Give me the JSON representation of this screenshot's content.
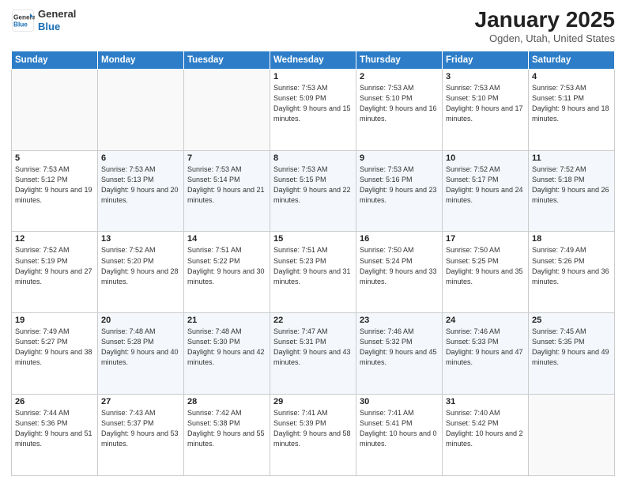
{
  "header": {
    "logo_line1": "General",
    "logo_line2": "Blue",
    "month": "January 2025",
    "location": "Ogden, Utah, United States"
  },
  "days_of_week": [
    "Sunday",
    "Monday",
    "Tuesday",
    "Wednesday",
    "Thursday",
    "Friday",
    "Saturday"
  ],
  "weeks": [
    [
      {
        "num": "",
        "sunrise": "",
        "sunset": "",
        "daylight": ""
      },
      {
        "num": "",
        "sunrise": "",
        "sunset": "",
        "daylight": ""
      },
      {
        "num": "",
        "sunrise": "",
        "sunset": "",
        "daylight": ""
      },
      {
        "num": "1",
        "sunrise": "Sunrise: 7:53 AM",
        "sunset": "Sunset: 5:09 PM",
        "daylight": "Daylight: 9 hours and 15 minutes."
      },
      {
        "num": "2",
        "sunrise": "Sunrise: 7:53 AM",
        "sunset": "Sunset: 5:10 PM",
        "daylight": "Daylight: 9 hours and 16 minutes."
      },
      {
        "num": "3",
        "sunrise": "Sunrise: 7:53 AM",
        "sunset": "Sunset: 5:10 PM",
        "daylight": "Daylight: 9 hours and 17 minutes."
      },
      {
        "num": "4",
        "sunrise": "Sunrise: 7:53 AM",
        "sunset": "Sunset: 5:11 PM",
        "daylight": "Daylight: 9 hours and 18 minutes."
      }
    ],
    [
      {
        "num": "5",
        "sunrise": "Sunrise: 7:53 AM",
        "sunset": "Sunset: 5:12 PM",
        "daylight": "Daylight: 9 hours and 19 minutes."
      },
      {
        "num": "6",
        "sunrise": "Sunrise: 7:53 AM",
        "sunset": "Sunset: 5:13 PM",
        "daylight": "Daylight: 9 hours and 20 minutes."
      },
      {
        "num": "7",
        "sunrise": "Sunrise: 7:53 AM",
        "sunset": "Sunset: 5:14 PM",
        "daylight": "Daylight: 9 hours and 21 minutes."
      },
      {
        "num": "8",
        "sunrise": "Sunrise: 7:53 AM",
        "sunset": "Sunset: 5:15 PM",
        "daylight": "Daylight: 9 hours and 22 minutes."
      },
      {
        "num": "9",
        "sunrise": "Sunrise: 7:53 AM",
        "sunset": "Sunset: 5:16 PM",
        "daylight": "Daylight: 9 hours and 23 minutes."
      },
      {
        "num": "10",
        "sunrise": "Sunrise: 7:52 AM",
        "sunset": "Sunset: 5:17 PM",
        "daylight": "Daylight: 9 hours and 24 minutes."
      },
      {
        "num": "11",
        "sunrise": "Sunrise: 7:52 AM",
        "sunset": "Sunset: 5:18 PM",
        "daylight": "Daylight: 9 hours and 26 minutes."
      }
    ],
    [
      {
        "num": "12",
        "sunrise": "Sunrise: 7:52 AM",
        "sunset": "Sunset: 5:19 PM",
        "daylight": "Daylight: 9 hours and 27 minutes."
      },
      {
        "num": "13",
        "sunrise": "Sunrise: 7:52 AM",
        "sunset": "Sunset: 5:20 PM",
        "daylight": "Daylight: 9 hours and 28 minutes."
      },
      {
        "num": "14",
        "sunrise": "Sunrise: 7:51 AM",
        "sunset": "Sunset: 5:22 PM",
        "daylight": "Daylight: 9 hours and 30 minutes."
      },
      {
        "num": "15",
        "sunrise": "Sunrise: 7:51 AM",
        "sunset": "Sunset: 5:23 PM",
        "daylight": "Daylight: 9 hours and 31 minutes."
      },
      {
        "num": "16",
        "sunrise": "Sunrise: 7:50 AM",
        "sunset": "Sunset: 5:24 PM",
        "daylight": "Daylight: 9 hours and 33 minutes."
      },
      {
        "num": "17",
        "sunrise": "Sunrise: 7:50 AM",
        "sunset": "Sunset: 5:25 PM",
        "daylight": "Daylight: 9 hours and 35 minutes."
      },
      {
        "num": "18",
        "sunrise": "Sunrise: 7:49 AM",
        "sunset": "Sunset: 5:26 PM",
        "daylight": "Daylight: 9 hours and 36 minutes."
      }
    ],
    [
      {
        "num": "19",
        "sunrise": "Sunrise: 7:49 AM",
        "sunset": "Sunset: 5:27 PM",
        "daylight": "Daylight: 9 hours and 38 minutes."
      },
      {
        "num": "20",
        "sunrise": "Sunrise: 7:48 AM",
        "sunset": "Sunset: 5:28 PM",
        "daylight": "Daylight: 9 hours and 40 minutes."
      },
      {
        "num": "21",
        "sunrise": "Sunrise: 7:48 AM",
        "sunset": "Sunset: 5:30 PM",
        "daylight": "Daylight: 9 hours and 42 minutes."
      },
      {
        "num": "22",
        "sunrise": "Sunrise: 7:47 AM",
        "sunset": "Sunset: 5:31 PM",
        "daylight": "Daylight: 9 hours and 43 minutes."
      },
      {
        "num": "23",
        "sunrise": "Sunrise: 7:46 AM",
        "sunset": "Sunset: 5:32 PM",
        "daylight": "Daylight: 9 hours and 45 minutes."
      },
      {
        "num": "24",
        "sunrise": "Sunrise: 7:46 AM",
        "sunset": "Sunset: 5:33 PM",
        "daylight": "Daylight: 9 hours and 47 minutes."
      },
      {
        "num": "25",
        "sunrise": "Sunrise: 7:45 AM",
        "sunset": "Sunset: 5:35 PM",
        "daylight": "Daylight: 9 hours and 49 minutes."
      }
    ],
    [
      {
        "num": "26",
        "sunrise": "Sunrise: 7:44 AM",
        "sunset": "Sunset: 5:36 PM",
        "daylight": "Daylight: 9 hours and 51 minutes."
      },
      {
        "num": "27",
        "sunrise": "Sunrise: 7:43 AM",
        "sunset": "Sunset: 5:37 PM",
        "daylight": "Daylight: 9 hours and 53 minutes."
      },
      {
        "num": "28",
        "sunrise": "Sunrise: 7:42 AM",
        "sunset": "Sunset: 5:38 PM",
        "daylight": "Daylight: 9 hours and 55 minutes."
      },
      {
        "num": "29",
        "sunrise": "Sunrise: 7:41 AM",
        "sunset": "Sunset: 5:39 PM",
        "daylight": "Daylight: 9 hours and 58 minutes."
      },
      {
        "num": "30",
        "sunrise": "Sunrise: 7:41 AM",
        "sunset": "Sunset: 5:41 PM",
        "daylight": "Daylight: 10 hours and 0 minutes."
      },
      {
        "num": "31",
        "sunrise": "Sunrise: 7:40 AM",
        "sunset": "Sunset: 5:42 PM",
        "daylight": "Daylight: 10 hours and 2 minutes."
      },
      {
        "num": "",
        "sunrise": "",
        "sunset": "",
        "daylight": ""
      }
    ]
  ]
}
